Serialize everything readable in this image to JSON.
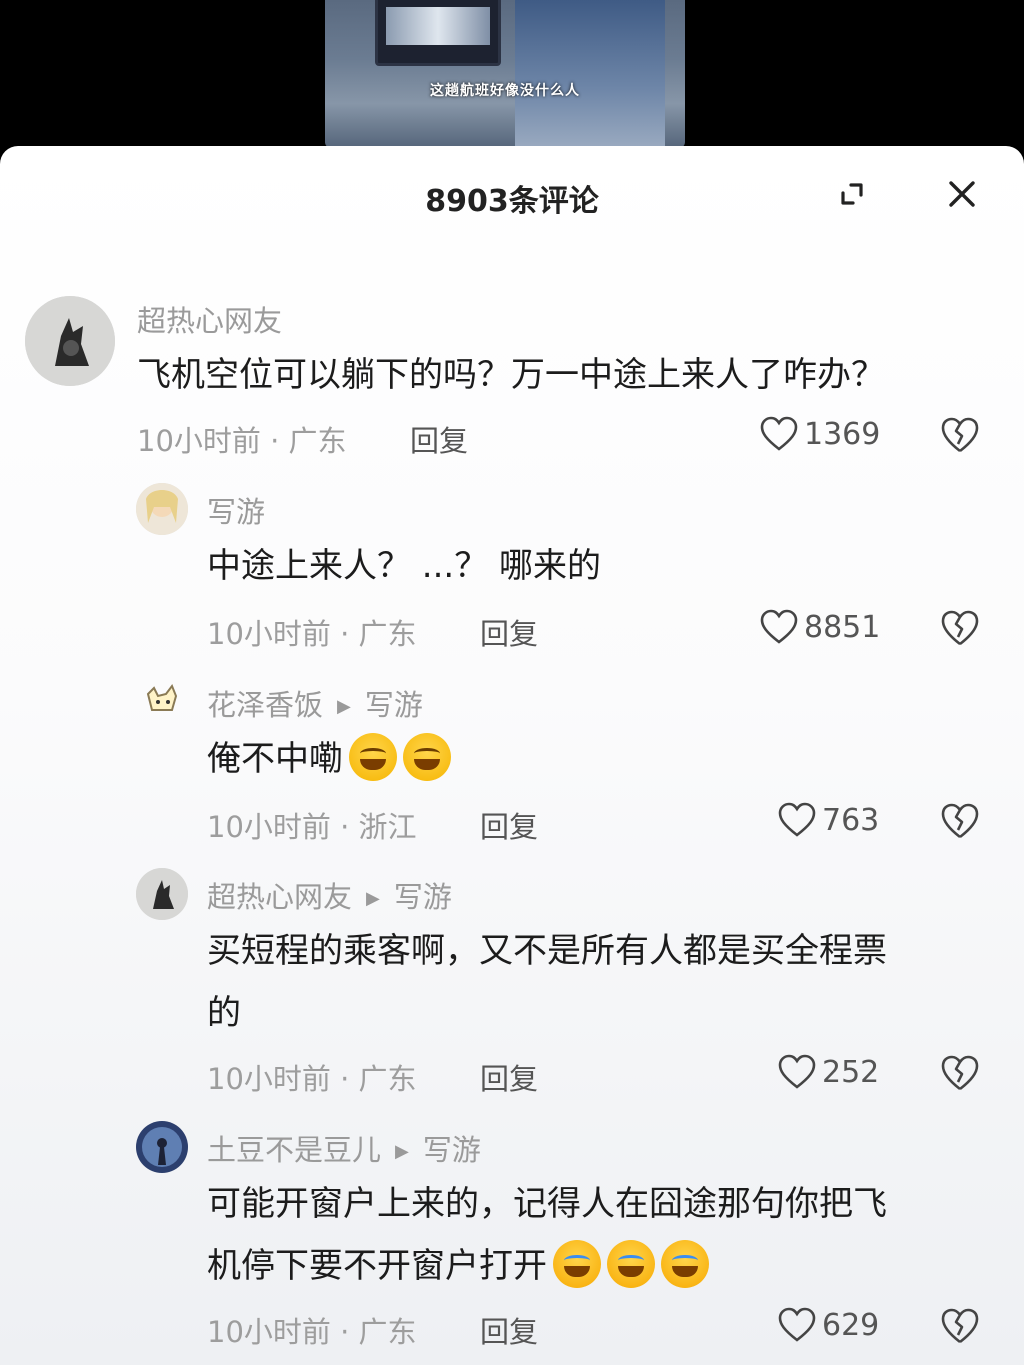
{
  "video": {
    "caption": "这趟航班好像没什么人"
  },
  "sheet": {
    "title": "8903条评论"
  },
  "comments": [
    {
      "username": "超热心网友",
      "text": "飞机空位可以躺下的吗？万一中途上来人了咋办？",
      "meta": "10小时前 · 广东",
      "reply": "回复",
      "likes": "1369"
    },
    {
      "username": "写游",
      "text": "中途上来人？ ...？ 哪来的",
      "meta": "10小时前 · 广东",
      "reply": "回复",
      "likes": "8851"
    },
    {
      "username": "花泽香饭",
      "reply_to": "写游",
      "text": "俺不中嘞",
      "emojis": [
        "grin",
        "grin"
      ],
      "meta": "10小时前 · 浙江",
      "reply": "回复",
      "likes": "763"
    },
    {
      "username": "超热心网友",
      "reply_to": "写游",
      "text_line1": "买短程的乘客啊，又不是所有人都是买全程票",
      "text_line2": "的",
      "meta": "10小时前 · 广东",
      "reply": "回复",
      "likes": "252"
    },
    {
      "username": "土豆不是豆儿",
      "reply_to": "写游",
      "text_line1": "可能开窗户上来的，记得人在囧途那句你把飞",
      "text_line2": "机停下要不开窗户打开",
      "emojis": [
        "laugh-cry",
        "laugh-cry",
        "laugh-cry"
      ],
      "meta": "10小时前 · 广东",
      "reply": "回复",
      "likes": "629"
    }
  ]
}
